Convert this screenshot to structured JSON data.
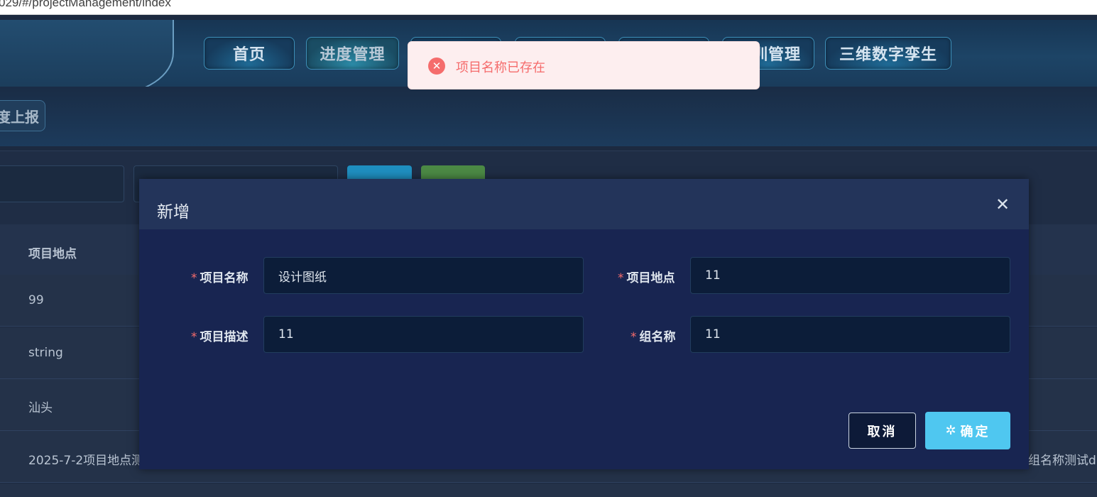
{
  "browser": {
    "url_fragment": "029/#/projectManagement/index"
  },
  "nav": {
    "items": [
      {
        "label": "首页",
        "active": false
      },
      {
        "label": "进度管理",
        "active": true
      },
      {
        "label": "",
        "active": false
      },
      {
        "label": "",
        "active": false
      },
      {
        "label": "",
        "active": false
      },
      {
        "label": "训管理",
        "active": false
      },
      {
        "label": "三维数字孪生",
        "active": false
      }
    ],
    "sub_tab_label": "度上报"
  },
  "table": {
    "column_header": "项目地点",
    "rows": [
      {
        "location": "99",
        "right": ""
      },
      {
        "location": "string",
        "right": ""
      },
      {
        "location": "汕头",
        "right": ""
      },
      {
        "location": "2025-7-2项目地点测",
        "right": "组名称测试d"
      }
    ]
  },
  "modal": {
    "title": "新增",
    "close_icon": "close-icon",
    "required_mark": "*",
    "fields": {
      "project_name": {
        "label": "项目名称",
        "value": "设计图纸"
      },
      "project_location": {
        "label": "项目地点",
        "value": "11"
      },
      "project_desc": {
        "label": "项目描述",
        "value": "11"
      },
      "group_name": {
        "label": "组名称",
        "value": "11"
      }
    },
    "cancel_label": "取消",
    "ok_label": "确定"
  },
  "toast": {
    "type": "error",
    "icon": "error-circle-icon",
    "message": "项目名称已存在"
  },
  "colors": {
    "accent": "#4fc7f0",
    "error": "#f56c6c",
    "modal_bg": "#182551"
  }
}
